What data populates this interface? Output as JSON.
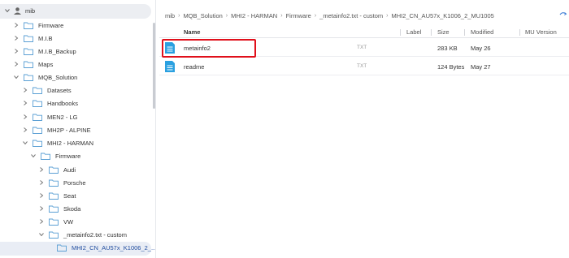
{
  "sidebar": {
    "root_label": "mib",
    "tree": [
      {
        "label": "Firmware",
        "expanded": false
      },
      {
        "label": "M.I.B",
        "expanded": false
      },
      {
        "label": "M.I.B_Backup",
        "expanded": false
      },
      {
        "label": "Maps",
        "expanded": false
      },
      {
        "label": "MQB_Solution",
        "expanded": true
      },
      {
        "label": "Datasets",
        "expanded": false
      },
      {
        "label": "Handbooks",
        "expanded": false
      },
      {
        "label": "MEN2 - LG",
        "expanded": false
      },
      {
        "label": "MH2P - ALPINE",
        "expanded": false
      },
      {
        "label": "MHI2 - HARMAN",
        "expanded": true
      },
      {
        "label": "Firmware",
        "expanded": true
      },
      {
        "label": "Audi",
        "expanded": false
      },
      {
        "label": "Porsche",
        "expanded": false
      },
      {
        "label": "Seat",
        "expanded": false
      },
      {
        "label": "Skoda",
        "expanded": false
      },
      {
        "label": "VW",
        "expanded": false
      },
      {
        "label": "_metainfo2.txt - custom",
        "expanded": true
      },
      {
        "label": "MHI2_CN_AU57x_K1006_2_...",
        "selected": true
      }
    ]
  },
  "breadcrumb": [
    "mib",
    "MQB_Solution",
    "MHI2 - HARMAN",
    "Firmware",
    "_metainfo2.txt - custom",
    "MHI2_CN_AU57x_K1006_2_MU1005"
  ],
  "table": {
    "columns": {
      "name": "Name",
      "label": "Label",
      "size": "Size",
      "modified": "Modified",
      "version": "MU Version"
    },
    "rows": [
      {
        "name": "metainfo2",
        "type": "TXT",
        "size": "283 KB",
        "modified": "May 26"
      },
      {
        "name": "readme",
        "type": "TXT",
        "size": "124 Bytes",
        "modified": "May 27"
      }
    ]
  },
  "colors": {
    "highlight": "#e0101b",
    "folder": "#5a9fd4",
    "file_icon": "#2aa0e0"
  }
}
